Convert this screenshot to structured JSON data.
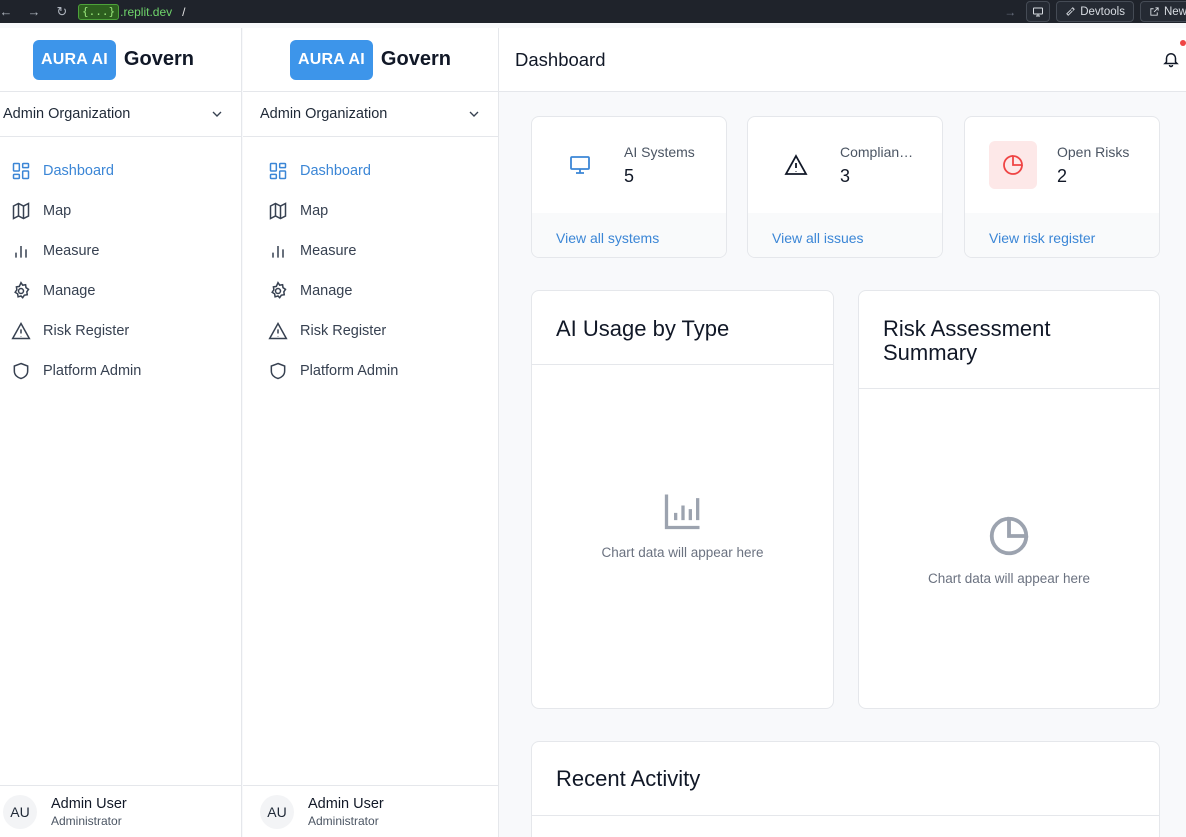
{
  "browser": {
    "url_chip": "{...}",
    "url_host": ".replit.dev",
    "url_path": "/",
    "devtools_label": "Devtools",
    "new_label": "New"
  },
  "brand": {
    "badge": "AURA AI",
    "name": "Govern"
  },
  "org": {
    "selected": "Admin Organization"
  },
  "nav": [
    {
      "label": "Dashboard",
      "icon": "layout-grid-icon",
      "active": true
    },
    {
      "label": "Map",
      "icon": "map-icon"
    },
    {
      "label": "Measure",
      "icon": "bar-chart-icon"
    },
    {
      "label": "Manage",
      "icon": "gear-icon"
    },
    {
      "label": "Risk Register",
      "icon": "warning-icon"
    },
    {
      "label": "Platform Admin",
      "icon": "shield-icon"
    }
  ],
  "user": {
    "initials": "AU",
    "name": "Admin User",
    "role": "Administrator"
  },
  "header": {
    "title": "Dashboard"
  },
  "stats": [
    {
      "label": "AI Systems",
      "value": "5",
      "link": "View all systems",
      "icon": "monitor-icon"
    },
    {
      "label": "Compliance Issues",
      "value": "3",
      "link": "View all issues",
      "icon": "warning-icon"
    },
    {
      "label": "Open Risks",
      "value": "2",
      "link": "View risk register",
      "icon": "pie-chart-icon"
    }
  ],
  "charts": [
    {
      "title": "AI Usage by Type",
      "empty_text": "Chart data will appear here",
      "icon": "bar-chart-icon"
    },
    {
      "title": "Risk Assessment Summary",
      "empty_text": "Chart data will appear here",
      "icon": "pie-chart-icon"
    }
  ],
  "activity": {
    "title": "Recent Activity"
  },
  "colors": {
    "accent": "#3d95ea",
    "link": "#3b86d6",
    "danger": "#ef4444"
  }
}
